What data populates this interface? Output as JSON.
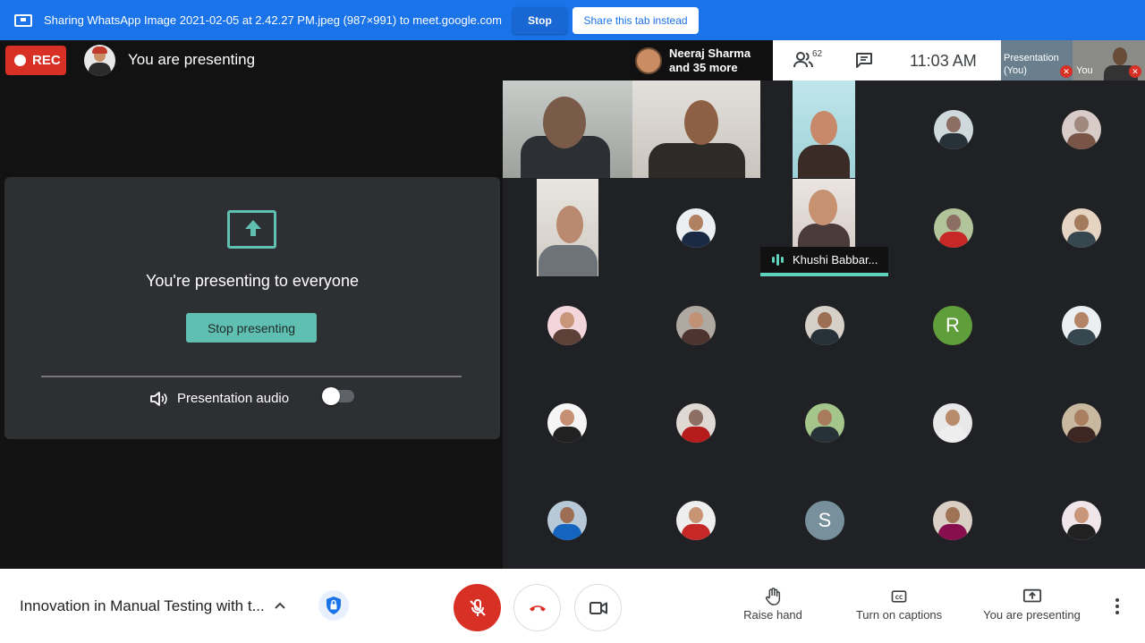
{
  "share_bar": {
    "message": "Sharing WhatsApp Image 2021-02-05 at 2.42.27 PM.jpeg (987×991) to meet.google.com",
    "stop_label": "Stop",
    "share_tab_label": "Share this tab instead"
  },
  "header": {
    "rec_label": "REC",
    "presenting_title": "You are presenting",
    "more_people": {
      "name": "Neeraj Sharma",
      "more": "and 35 more"
    },
    "people_count": "62",
    "clock": "11:03  AM",
    "self_tile": {
      "presentation_label_1": "Presentation",
      "presentation_label_2": "(You)",
      "you_label": "You"
    }
  },
  "present_panel": {
    "heading": "You're presenting to everyone",
    "stop_button": "Stop presenting",
    "audio_label": "Presentation audio",
    "audio_enabled": false
  },
  "participants": {
    "active_speaker": "Khushi Babbar...",
    "letter_avatars": [
      {
        "letter": "R",
        "color": "#5f9e3a"
      },
      {
        "letter": "S",
        "color": "#78909c"
      }
    ]
  },
  "bottom_bar": {
    "meeting_title": "Innovation in Manual Testing with t...",
    "raise_hand": "Raise hand",
    "captions": "Turn on captions",
    "presenting": "You are presenting",
    "icons": [
      "chevron-up-icon",
      "shield-lock-icon",
      "mic-off-icon",
      "call-end-icon",
      "videocam-icon",
      "hand-icon",
      "captions-icon",
      "present-screen-icon",
      "more-vert-icon"
    ]
  }
}
